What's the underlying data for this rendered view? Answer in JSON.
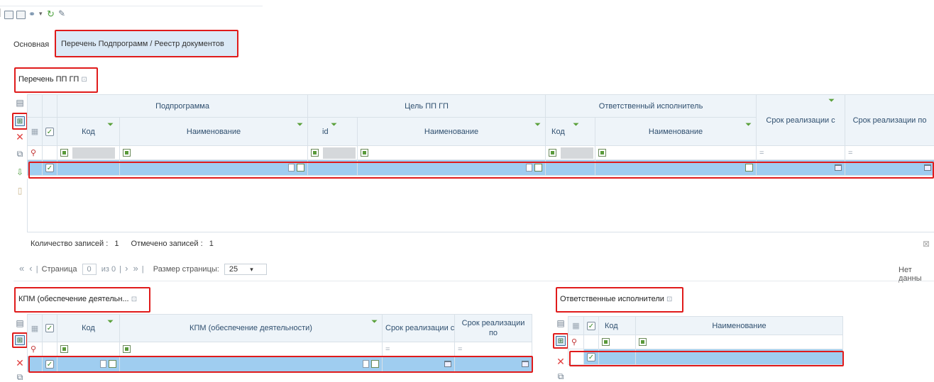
{
  "toolbar": {
    "icons": [
      "save-icon",
      "print-icon",
      "link-icon",
      "dropdown-icon",
      "refresh-icon",
      "edit-icon"
    ]
  },
  "tabs": [
    {
      "label": "Основная"
    },
    {
      "label": "Перечень Подпрограмм / Реестр документов"
    }
  ],
  "main_panel": {
    "title": "Перечень ПП ГП",
    "groups": {
      "subprogram": "Подпрограмма",
      "goal": "Цель ПП ГП",
      "responsible": "Ответственный исполнитель",
      "period_from": "Срок реализации с",
      "period_to": "Срок реализации по"
    },
    "columns": {
      "code": "Код",
      "name": "Наименование",
      "id": "id"
    },
    "filter_eq": "=",
    "footer": {
      "records_label": "Количество записей :",
      "records_value": "1",
      "marked_label": "Отмечено записей :",
      "marked_value": "1",
      "page_label": "Страница",
      "page_value": "0",
      "of_label": "из 0",
      "page_size_label": "Размер страницы:",
      "page_size_value": "25",
      "no_data": "Нет данны"
    }
  },
  "kpm_panel": {
    "title": "КПМ (обеспечение деятельн...",
    "columns": {
      "code": "Код",
      "kpm": "КПМ (обеспечение деятельности)",
      "period_from": "Срок реализации с",
      "period_to": "Срок реализации по"
    },
    "filter_eq": "="
  },
  "resp_panel": {
    "title": "Ответственные исполнители",
    "columns": {
      "code": "Код",
      "name": "Наименование"
    }
  },
  "colors": {
    "highlight": "#e01b1b",
    "selected_row": "#9fcdf0",
    "header_bg": "#eef4f9",
    "tab_active": "#dbe9f6"
  }
}
